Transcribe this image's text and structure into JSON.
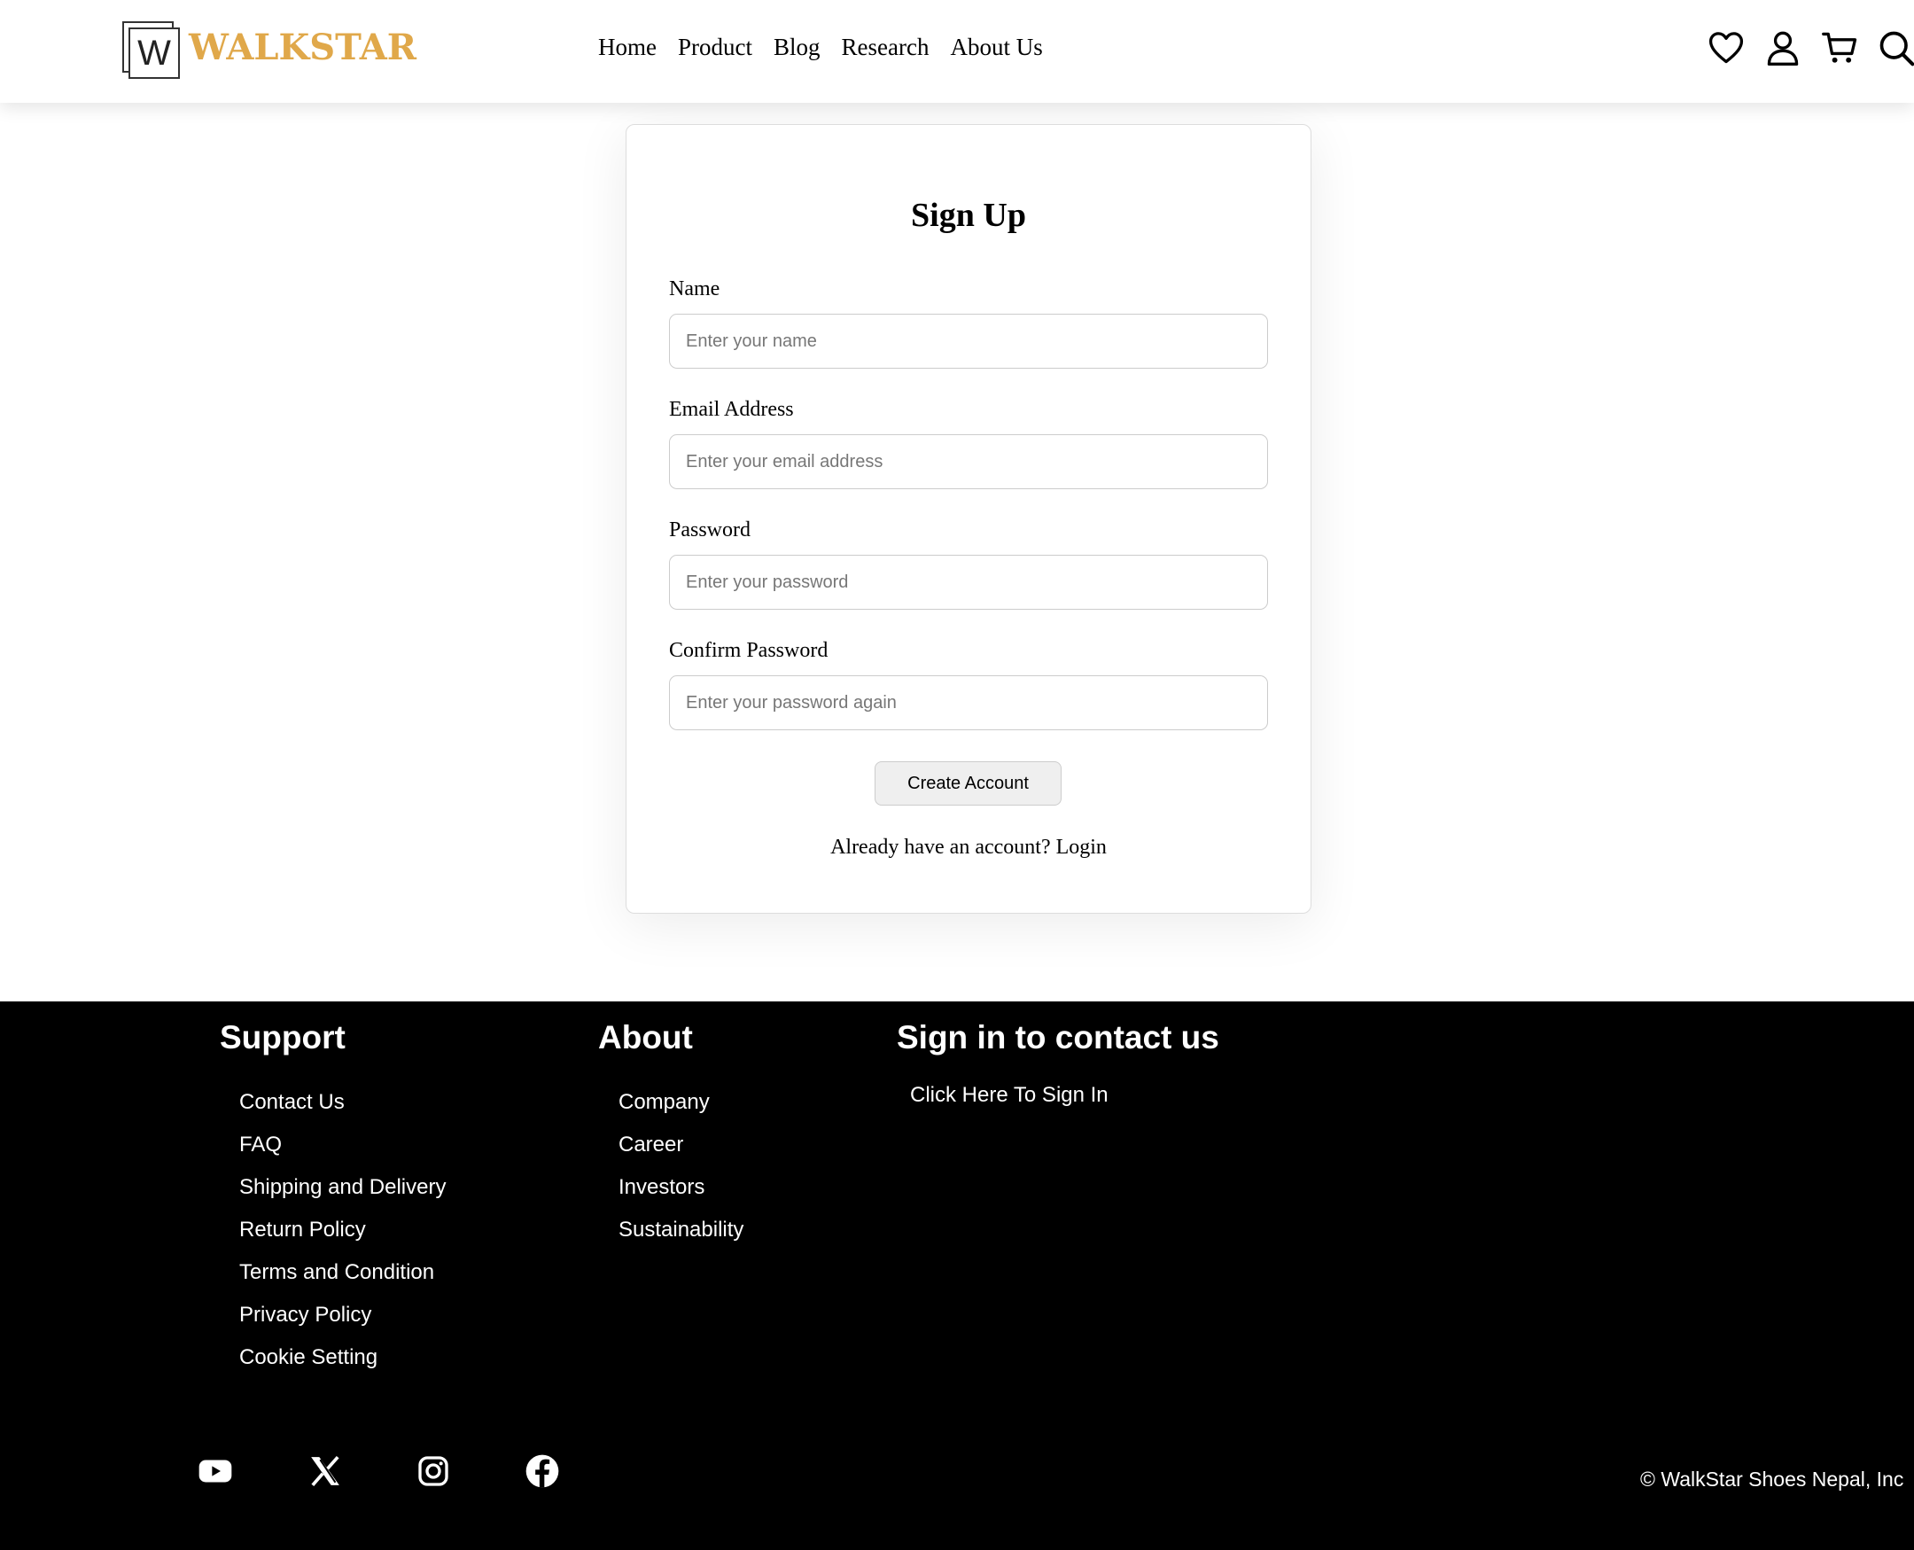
{
  "brand": {
    "logo_letter": "W",
    "name": "WALKSTAR",
    "accent_color": "#e0a84a"
  },
  "nav": {
    "items": [
      "Home",
      "Product",
      "Blog",
      "Research",
      "About Us"
    ]
  },
  "header_icons": [
    "heart-icon",
    "user-icon",
    "cart-icon",
    "search-icon"
  ],
  "form": {
    "title": "Sign Up",
    "name_label": "Name",
    "name_placeholder": "Enter your name",
    "email_label": "Email Address",
    "email_placeholder": "Enter your email address",
    "password_label": "Password",
    "password_placeholder": "Enter your password",
    "confirm_label": "Confirm Password",
    "confirm_placeholder": "Enter your password again",
    "submit_label": "Create Account",
    "login_text": "Already have an account? Login"
  },
  "footer": {
    "support": {
      "heading": "Support",
      "items": [
        "Contact Us",
        "FAQ",
        "Shipping and Delivery",
        "Return Policy",
        "Terms and Condition",
        "Privacy Policy",
        "Cookie Setting"
      ]
    },
    "about": {
      "heading": "About",
      "items": [
        "Company",
        "Career",
        "Investors",
        "Sustainability"
      ]
    },
    "contact": {
      "heading": "Sign in to contact us",
      "link": "Click Here To Sign In"
    },
    "social_icons": [
      "youtube-icon",
      "x-icon",
      "instagram-icon",
      "facebook-icon"
    ],
    "copyright": "© WalkStar Shoes Nepal, Inc"
  }
}
